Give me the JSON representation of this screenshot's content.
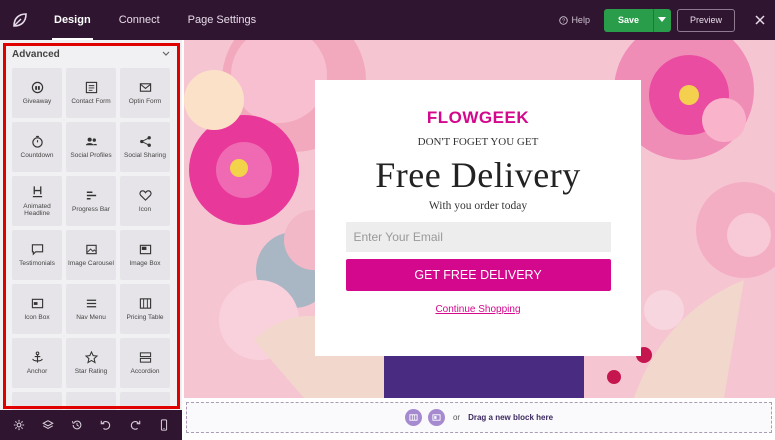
{
  "topbar": {
    "tabs": [
      "Design",
      "Connect",
      "Page Settings"
    ],
    "help_label": "Help",
    "save_label": "Save",
    "preview_label": "Preview"
  },
  "sidebar": {
    "section_title": "Advanced",
    "widgets": [
      {
        "label": "Giveaway",
        "icon": "giveaway-icon"
      },
      {
        "label": "Contact Form",
        "icon": "contact-form-icon"
      },
      {
        "label": "Optin Form",
        "icon": "envelope-icon"
      },
      {
        "label": "Countdown",
        "icon": "stopwatch-icon"
      },
      {
        "label": "Social Profiles",
        "icon": "users-icon"
      },
      {
        "label": "Social Sharing",
        "icon": "share-icon"
      },
      {
        "label": "Animated Headline",
        "icon": "heading-icon"
      },
      {
        "label": "Progress Bar",
        "icon": "progress-bar-icon"
      },
      {
        "label": "Icon",
        "icon": "heart-icon"
      },
      {
        "label": "Testimonials",
        "icon": "speech-bubble-icon"
      },
      {
        "label": "Image Carousel",
        "icon": "image-carousel-icon"
      },
      {
        "label": "Image Box",
        "icon": "image-box-icon"
      },
      {
        "label": "Icon Box",
        "icon": "icon-box-icon"
      },
      {
        "label": "Nav Menu",
        "icon": "hamburger-icon"
      },
      {
        "label": "Pricing Table",
        "icon": "pricing-table-icon"
      },
      {
        "label": "Anchor",
        "icon": "anchor-icon"
      },
      {
        "label": "Star Rating",
        "icon": "star-icon"
      },
      {
        "label": "Accordion",
        "icon": "accordion-icon"
      },
      {
        "label": "",
        "icon": "partial-icon"
      },
      {
        "label": "",
        "icon": "partial-icon"
      },
      {
        "label": "",
        "icon": "partial-icon"
      }
    ]
  },
  "canvas": {
    "brand": "FLOWGEEK",
    "subtitle": "DON'T FOGET YOU GET",
    "headline": "Free Delivery",
    "tagline": "With you order today",
    "email_placeholder": "Enter Your Email",
    "cta_label": "GET FREE DELIVERY",
    "continue_label": "Continue Shopping"
  },
  "dropzone": {
    "or_label": "or",
    "text": "Drag a new block here"
  },
  "colors": {
    "topbar_bg": "#2f1530",
    "accent": "#d4088c",
    "save_green": "#2a9d4b",
    "highlight_red": "#e00000"
  }
}
